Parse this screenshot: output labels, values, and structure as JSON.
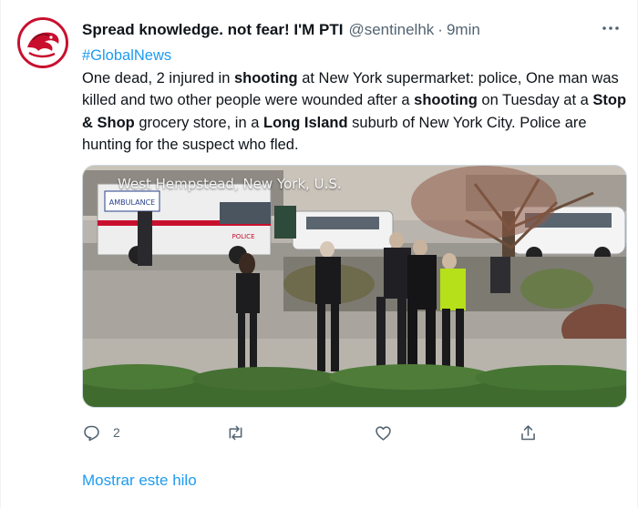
{
  "tweet": {
    "display_name": "Spread knowledge. not fear! I'M PTI",
    "handle": "@sentinelhk",
    "separator": "·",
    "time": "9min",
    "more_icon": "more-horizontal-icon",
    "hashtag": "#GlobalNews",
    "text_parts": {
      "p1": "One dead, 2 injured in ",
      "b1": "shooting",
      "p2": " at New York supermarket: police, One man was killed and two other people were wounded after a ",
      "b2": "shooting",
      "p3": " on Tuesday at a ",
      "b3": "Stop & Shop",
      "p4": " grocery store, in a ",
      "b4": "Long Island",
      "p5": " suburb of New York City. Police are hunting for the suspect who fled."
    },
    "media": {
      "caption": "West Hempstead, New York, U.S.",
      "ambulance_text": "AMBULANCE",
      "police_text": "POLICE"
    },
    "actions": {
      "reply_count": "2",
      "retweet_count": "",
      "like_count": "",
      "icons": [
        "reply-icon",
        "retweet-icon",
        "like-icon",
        "share-icon"
      ]
    },
    "show_thread": "Mostrar este hilo",
    "colors": {
      "accent": "#1d9bf0",
      "text": "#0f1419",
      "muted": "#536471"
    }
  }
}
